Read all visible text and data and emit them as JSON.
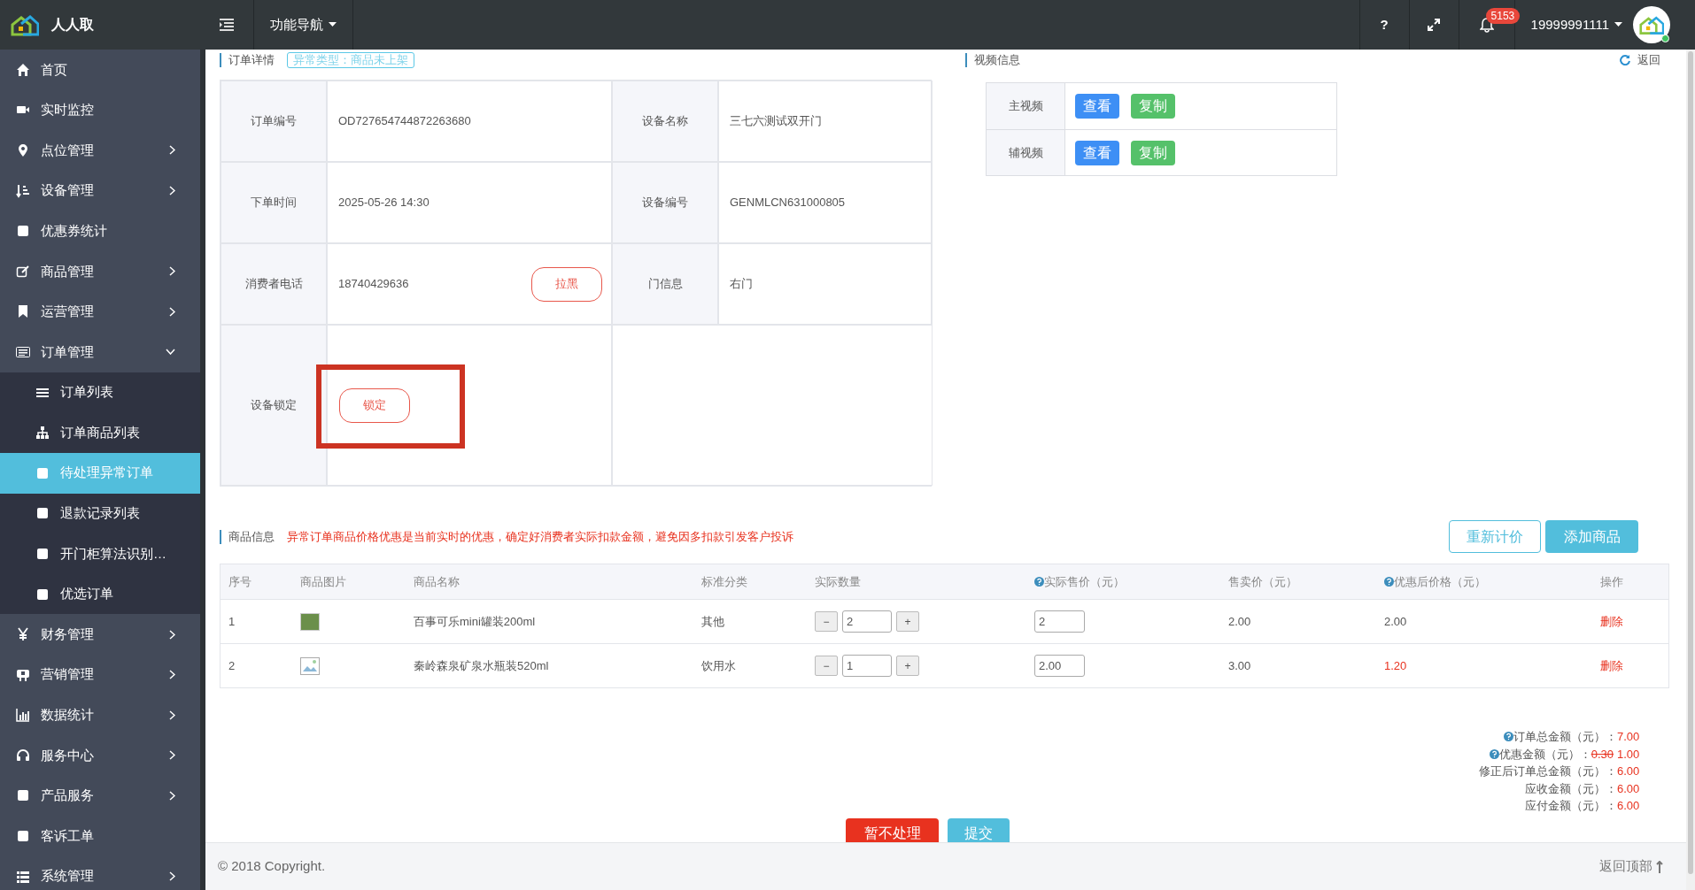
{
  "topbar": {
    "brand": "人人取",
    "nav_menu": "功能导航",
    "help": "?",
    "notification_count": "5153",
    "username": "19999991111"
  },
  "sidebar": {
    "items": [
      {
        "label": "首页",
        "selected": false
      },
      {
        "label": "实时监控",
        "selected": false
      },
      {
        "label": "点位管理",
        "selected": false,
        "expanded": false
      },
      {
        "label": "设备管理",
        "selected": false,
        "expanded": false
      },
      {
        "label": "优惠券统计",
        "selected": false
      },
      {
        "label": "商品管理",
        "selected": false,
        "expanded": false
      },
      {
        "label": "运营管理",
        "selected": false,
        "expanded": false
      },
      {
        "label": "订单管理",
        "selected": false,
        "expanded": true,
        "children": [
          {
            "label": "订单列表",
            "selected": false
          },
          {
            "label": "订单商品列表",
            "selected": false
          },
          {
            "label": "待处理异常订单",
            "selected": true
          },
          {
            "label": "退款记录列表",
            "selected": false
          },
          {
            "label": "开门柜算法识别…",
            "selected": false
          },
          {
            "label": "优选订单",
            "selected": false
          }
        ]
      },
      {
        "label": "财务管理",
        "selected": false,
        "expanded": false
      },
      {
        "label": "营销管理",
        "selected": false,
        "expanded": false
      },
      {
        "label": "数据统计",
        "selected": false,
        "expanded": false
      },
      {
        "label": "服务中心",
        "selected": false,
        "expanded": false
      },
      {
        "label": "产品服务",
        "selected": false,
        "expanded": false
      },
      {
        "label": "客诉工单",
        "selected": false
      },
      {
        "label": "系统管理",
        "selected": false,
        "expanded": false
      }
    ]
  },
  "order_detail": {
    "title": "订单详情",
    "exception_tag": "异常类型：商品未上架",
    "fields": [
      {
        "label": "订单编号",
        "value": "OD727654744872263680"
      },
      {
        "label": "设备名称",
        "value": "三七六测试双开门"
      },
      {
        "label": "下单时间",
        "value": "2025-05-26 14:30"
      },
      {
        "label": "设备编号",
        "value": "GENMLCN631000805"
      },
      {
        "label": "消费者电话",
        "value": "18740429636",
        "button": "拉黑"
      },
      {
        "label": "门信息",
        "value": "右门"
      }
    ],
    "device_lock": {
      "label": "设备锁定",
      "button": "锁定"
    }
  },
  "video_info": {
    "title": "视频信息",
    "refresh": "返回",
    "rows": [
      {
        "label": "主视频",
        "view": "查看",
        "copy": "复制"
      },
      {
        "label": "辅视频",
        "view": "查看",
        "copy": "复制"
      }
    ]
  },
  "goods": {
    "title": "商品信息",
    "warning": "异常订单商品价格优惠是当前实时的优惠，确定好消费者实际扣款金额，避免因多扣款引发客户投诉",
    "buttons": [
      "重新计价",
      "添加商品"
    ],
    "columns": [
      "序号",
      "商品图片",
      "商品名称",
      "标准分类",
      "实际数量",
      "实际售价（元）",
      "售卖价（元）",
      "优惠后价格（元）",
      "操作"
    ],
    "rows": [
      {
        "index": "1",
        "kind": "photo",
        "name": "百事可乐mini罐装200ml",
        "category": "其他",
        "minus": "−",
        "quantity": "2",
        "plus": "+",
        "actual_price": "2",
        "sale_price": "2.00",
        "discounted_price": "2.00",
        "discount_changed": false,
        "action": "删除"
      },
      {
        "index": "2",
        "kind": "broken",
        "name": "秦岭森泉矿泉水瓶装520ml",
        "category": "饮用水",
        "minus": "−",
        "quantity": "1",
        "plus": "+",
        "actual_price": "2.00",
        "sale_price": "3.00",
        "discounted_price": "1.20",
        "discount_changed": true,
        "action": "删除"
      }
    ]
  },
  "totals": [
    {
      "label": "订单总金额（元）：",
      "value": "7.00",
      "help": true
    },
    {
      "label": "优惠金额（元）：",
      "old_value": "0.30",
      "value": "1.00",
      "help": true
    },
    {
      "label": "修正后订单总金额（元）：",
      "value": "6.00",
      "help": false
    },
    {
      "label": "应收金额（元）：",
      "value": "6.00",
      "help": false
    },
    {
      "label": "应付金额（元）：",
      "value": "6.00",
      "help": false
    }
  ],
  "actions": [
    "暂不处理",
    "提交"
  ],
  "footer": {
    "copyright": "© 2018 Copyright.",
    "back_to_top": "返回顶部"
  }
}
